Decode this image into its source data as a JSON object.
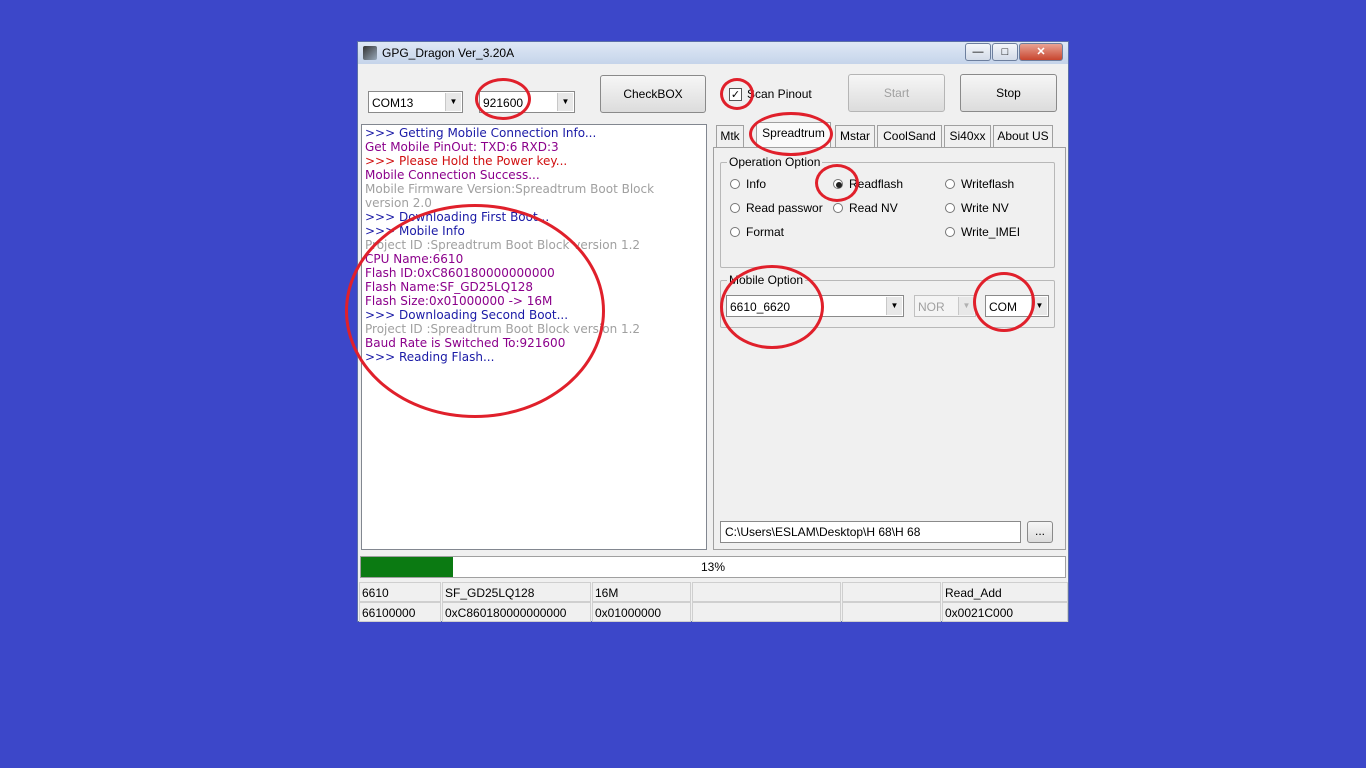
{
  "window": {
    "title": "GPG_Dragon  Ver_3.20A"
  },
  "toolbar": {
    "port": "COM13",
    "baud": "921600",
    "checkbox_label": "CheckBOX",
    "scan_pinout_label": "Scan Pinout",
    "scan_pinout_checked": true,
    "start_label": "Start",
    "stop_label": "Stop"
  },
  "log": [
    {
      "text": ">>> Getting Mobile Connection Info...",
      "color": "#1a1aa6"
    },
    {
      "text": "   Get Mobile PinOut: TXD:6  RXD:3",
      "color": "#8b008b"
    },
    {
      "text": ">>> Please Hold the Power key...",
      "color": "#d01010"
    },
    {
      "text": "   Mobile Connection Success...",
      "color": "#8b008b"
    },
    {
      "text": "   Mobile Firmware Version:Spreadtrum Boot Block version 2.0",
      "color": "#a0a0a0"
    },
    {
      "text": ">>> Downloading First Boot...",
      "color": "#1a1aa6"
    },
    {
      "text": ">>> Mobile Info",
      "color": "#1a1aa6"
    },
    {
      "text": "   Project ID :Spreadtrum Boot Block version 1.2",
      "color": "#a0a0a0"
    },
    {
      "text": "   CPU Name:6610",
      "color": "#8b008b"
    },
    {
      "text": "   Flash ID:0xC860180000000000",
      "color": "#8b008b"
    },
    {
      "text": "   Flash Name:SF_GD25LQ128",
      "color": "#8b008b"
    },
    {
      "text": "   Flash Size:0x01000000  -> 16M",
      "color": "#8b008b"
    },
    {
      "text": ">>> Downloading Second Boot...",
      "color": "#1a1aa6"
    },
    {
      "text": "   Project ID :Spreadtrum Boot Block version 1.2",
      "color": "#a0a0a0"
    },
    {
      "text": "    Baud Rate is Switched To:921600",
      "color": "#8b008b"
    },
    {
      "text": ">>> Reading Flash...",
      "color": "#1a1aa6"
    }
  ],
  "tabs": [
    {
      "label": "Mtk",
      "active": false
    },
    {
      "label": "Spreadtrum",
      "active": true
    },
    {
      "label": "Mstar",
      "active": false
    },
    {
      "label": "CoolSand",
      "active": false
    },
    {
      "label": "Si40xx",
      "active": false
    },
    {
      "label": "About US",
      "active": false
    }
  ],
  "operation": {
    "legend": "Operation Option",
    "options": [
      {
        "label": "Info",
        "selected": false
      },
      {
        "label": "Readflash",
        "selected": true
      },
      {
        "label": "Writeflash",
        "selected": false
      },
      {
        "label": "Read passwor",
        "selected": false
      },
      {
        "label": "Read NV",
        "selected": false
      },
      {
        "label": "Write NV",
        "selected": false
      },
      {
        "label": "Format",
        "selected": false
      },
      {
        "label": "Write_IMEI",
        "selected": false
      }
    ]
  },
  "mobile": {
    "legend": "Mobile Option",
    "model": "6610_6620",
    "flash_type": "NOR",
    "connection": "COM"
  },
  "file_path": "C:\\Users\\ESLAM\\Desktop\\H 68\\H 68",
  "browse_label": "...",
  "progress": {
    "value": 0.13,
    "label": "13%"
  },
  "status": {
    "row1": [
      "6610",
      "SF_GD25LQ128",
      "16M",
      "",
      "",
      "Read_Add"
    ],
    "row2": [
      "66100000",
      "0xC860180000000000",
      "0x01000000",
      "",
      "",
      "0x0021C000"
    ]
  },
  "colors": {
    "desktop": "#3c47c9",
    "annotation": "#e0202b",
    "progress": "#0b7a12"
  }
}
